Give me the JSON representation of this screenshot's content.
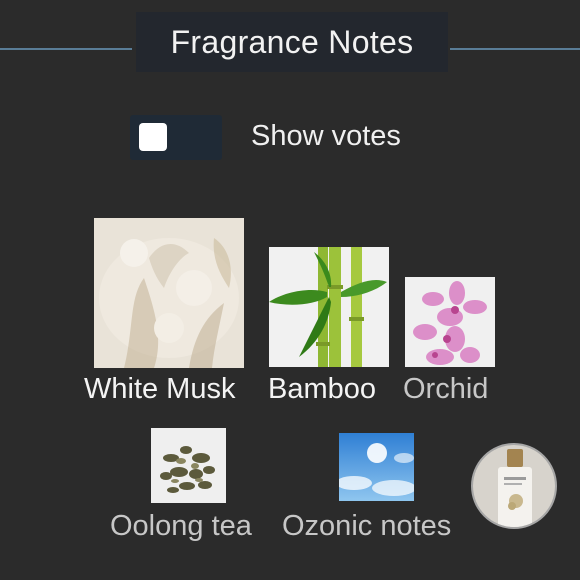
{
  "header": {
    "title": "Fragrance Notes"
  },
  "toggle": {
    "label": "Show votes",
    "state": "off"
  },
  "notes": [
    {
      "name": "White Musk",
      "image": "white-musk-image"
    },
    {
      "name": "Bamboo",
      "image": "bamboo-image"
    },
    {
      "name": "Orchid",
      "image": "orchid-image"
    },
    {
      "name": "Oolong tea",
      "image": "oolong-tea-image"
    },
    {
      "name": "Ozonic notes",
      "image": "ozonic-notes-image"
    }
  ],
  "fab": {
    "icon": "perfume-bottle-icon"
  },
  "colors": {
    "background": "#2b2b2b",
    "header_box": "#23272e",
    "header_line": "#5a7d97",
    "toggle_track": "#1f2a36"
  }
}
